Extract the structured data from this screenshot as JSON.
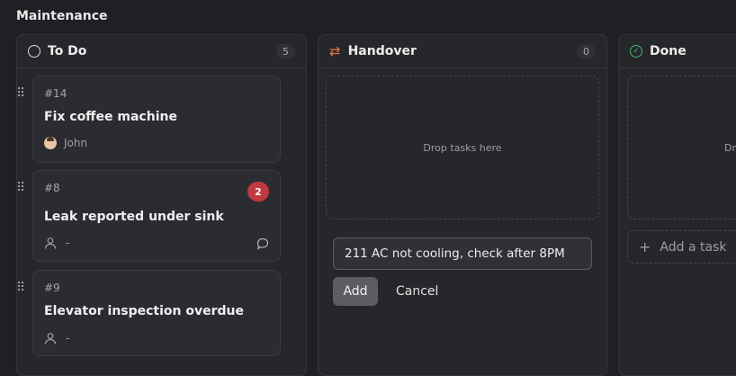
{
  "board": {
    "title": "Maintenance"
  },
  "columns": [
    {
      "title": "To Do",
      "count": "5",
      "icon": "circle-icon"
    },
    {
      "title": "Handover",
      "count": "0",
      "icon": "swap-icon",
      "accent": "#e8743b",
      "drop_text": "Drop tasks here"
    },
    {
      "title": "Done",
      "icon": "check-circle-icon",
      "accent": "#3fb96e",
      "drop_text": "Dr"
    }
  ],
  "todo_cards": [
    {
      "id": "#14",
      "title": "Fix coffee machine",
      "assignee": "John"
    },
    {
      "id": "#8",
      "title": "Leak reported under sink",
      "assignee": "-",
      "badge": "2"
    },
    {
      "id": "#9",
      "title": "Elevator inspection overdue",
      "assignee": "-"
    }
  ],
  "handover_form": {
    "input_value": "211 AC not cooling, check after 8PM",
    "add_label": "Add",
    "cancel_label": "Cancel"
  },
  "done_column": {
    "add_task_label": "Add a task"
  },
  "colors": {
    "background": "#1f2024",
    "column": "#26272b",
    "badge": "#c0393f"
  }
}
